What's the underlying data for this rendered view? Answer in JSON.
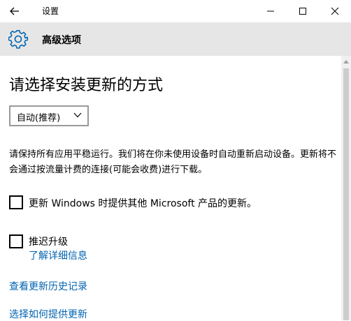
{
  "window": {
    "title": "设置",
    "back_icon": "arrow-left-icon",
    "minimize_icon": "minimize-icon",
    "maximize_icon": "maximize-icon",
    "close_icon": "close-icon"
  },
  "header": {
    "icon": "gear-icon",
    "title": "高级选项"
  },
  "main": {
    "heading": "请选择安装更新的方式",
    "install_mode": {
      "selected": "自动(推荐)",
      "icon": "chevron-down-icon"
    },
    "description": "请保持所有应用平稳运行。我们将在你未使用设备时自动重新启动设备。更新将不会通过按流量计费的连接(可能会收费)进行下载。",
    "options": [
      {
        "label": "更新 Windows 时提供其他 Microsoft 产品的更新。",
        "checked": false
      },
      {
        "label": "推迟升级",
        "checked": false
      }
    ],
    "learn_more": "了解详细信息",
    "links": {
      "history": "查看更新历史记录",
      "delivery": "选择如何提供更新"
    }
  },
  "colors": {
    "accent": "#0063b1",
    "header_bg": "#e6e6e6"
  }
}
